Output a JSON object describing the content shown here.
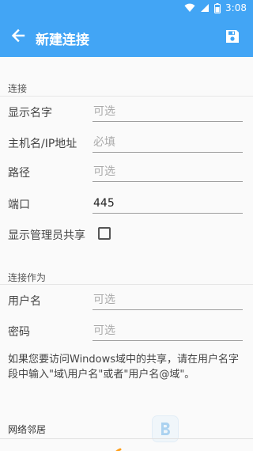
{
  "status_bar": {
    "time": "3:08"
  },
  "app_bar": {
    "title": "新建连接"
  },
  "sections": {
    "connection": "连接",
    "connect_as": "连接作为",
    "network": "网络邻居"
  },
  "form": {
    "display_name": {
      "label": "显示名字",
      "value": "",
      "placeholder": "可选"
    },
    "host": {
      "label": "主机名/IP地址",
      "value": "",
      "placeholder": "必填"
    },
    "path": {
      "label": "路径",
      "value": "",
      "placeholder": "可选"
    },
    "port": {
      "label": "端口",
      "value": "445",
      "placeholder": ""
    },
    "show_admin_share": {
      "label": "显示管理员共享",
      "checked": false
    },
    "username": {
      "label": "用户名",
      "value": "",
      "placeholder": "可选"
    },
    "password": {
      "label": "密码",
      "value": "",
      "placeholder": "可选"
    }
  },
  "help_text": "如果您要访问Windows域中的共享，请在用户名字段中输入\"域\\用户名\"或者\"用户名@域\"。",
  "icons": {
    "back": "arrow-left-icon",
    "save": "save-icon",
    "wifi": "wifi-icon",
    "signal": "signal-icon",
    "battery": "battery-icon"
  },
  "colors": {
    "primary": "#42a5f5",
    "background": "#fafafa"
  }
}
